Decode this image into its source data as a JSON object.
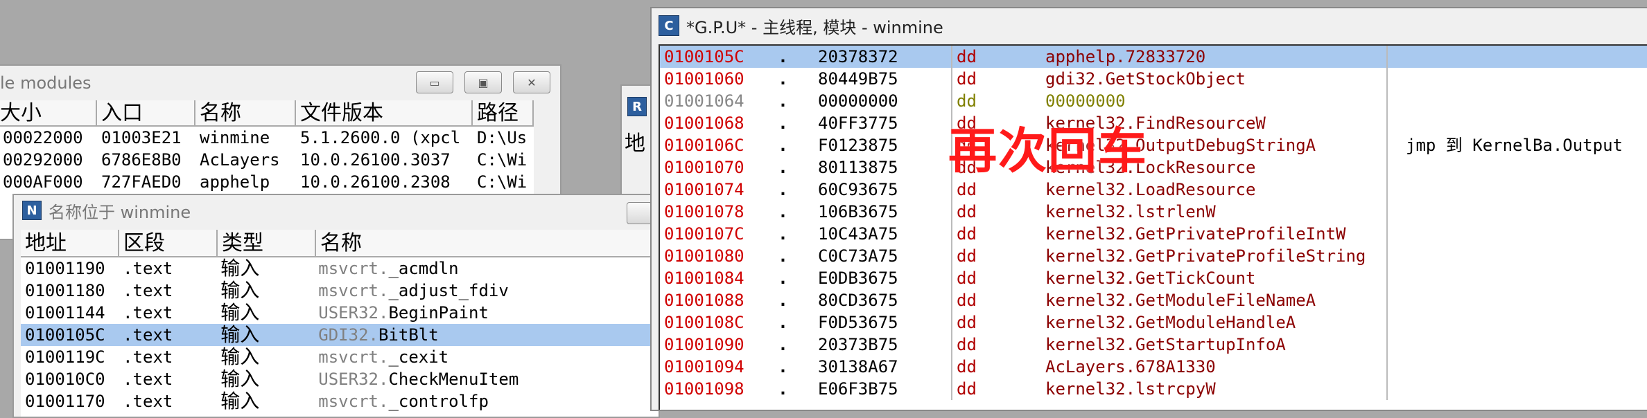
{
  "modules_window": {
    "title": "le modules",
    "buttons": [
      "▭",
      "▣",
      "✕"
    ],
    "columns": [
      "大小",
      "入口",
      "名称",
      "文件版本",
      "路径"
    ],
    "rows": [
      [
        "00022000",
        "01003E21",
        "winmine",
        "5.1.2600.0 (xpcl",
        "D:\\Us"
      ],
      [
        "00292000",
        "6786E8B0",
        "AcLayers",
        "10.0.26100.3037",
        "C:\\Wi"
      ],
      [
        "000AF000",
        "727FAED0",
        "apphelp",
        "10.0.26100.2308",
        "C:\\Wi"
      ]
    ]
  },
  "mini_window": {
    "icon": "R",
    "label": "地"
  },
  "names_window": {
    "icon": "N",
    "title": "名称位于 winmine",
    "columns": [
      "地址",
      "区段",
      "类型",
      "名称"
    ],
    "rows": [
      {
        "addr": "01001190",
        "section": ".text",
        "type": "输入",
        "mod": "msvcrt.",
        "fn": "_acmdln",
        "sel": false
      },
      {
        "addr": "01001180",
        "section": ".text",
        "type": "输入",
        "mod": "msvcrt.",
        "fn": "_adjust_fdiv",
        "sel": false
      },
      {
        "addr": "01001144",
        "section": ".text",
        "type": "输入",
        "mod": "USER32.",
        "fn": "BeginPaint",
        "sel": false
      },
      {
        "addr": "0100105C",
        "section": ".text",
        "type": "输入",
        "mod": "GDI32.",
        "fn": "BitBlt",
        "sel": true
      },
      {
        "addr": "0100119C",
        "section": ".text",
        "type": "输入",
        "mod": "msvcrt.",
        "fn": "_cexit",
        "sel": false
      },
      {
        "addr": "010010C0",
        "section": ".text",
        "type": "输入",
        "mod": "USER32.",
        "fn": "CheckMenuItem",
        "sel": false
      },
      {
        "addr": "01001170",
        "section": ".text",
        "type": "输入",
        "mod": "msvcrt.",
        "fn": "_controlfp",
        "sel": false
      }
    ]
  },
  "gpu_window": {
    "icon": "C",
    "title": "*G.P.U* -  主线程, 模块 - winmine",
    "rows": [
      {
        "addr": "0100105C",
        "dot": ".",
        "hex": "20378372",
        "op": "dd",
        "ref": "apphelp.72833720",
        "comment": "",
        "sel": true,
        "gray": false,
        "olive": false
      },
      {
        "addr": "01001060",
        "dot": ".",
        "hex": "80449B75",
        "op": "dd",
        "ref": "gdi32.GetStockObject",
        "comment": "",
        "sel": false,
        "gray": false,
        "olive": false
      },
      {
        "addr": "01001064",
        "dot": ".",
        "hex": "00000000",
        "op": "dd",
        "ref": "00000000",
        "comment": "",
        "sel": false,
        "gray": true,
        "olive": true
      },
      {
        "addr": "01001068",
        "dot": ".",
        "hex": "40FF3775",
        "op": "dd",
        "ref": "kernel32.FindResourceW",
        "comment": "",
        "sel": false,
        "gray": false,
        "olive": false
      },
      {
        "addr": "0100106C",
        "dot": ".",
        "hex": "F0123875",
        "op": "dd",
        "ref": "kernel32.OutputDebugStringA",
        "comment": "jmp 到 KernelBa.Output",
        "sel": false,
        "gray": false,
        "olive": false
      },
      {
        "addr": "01001070",
        "dot": ".",
        "hex": "80113875",
        "op": "dd",
        "ref": "kernel32.LockResource",
        "comment": "",
        "sel": false,
        "gray": false,
        "olive": false
      },
      {
        "addr": "01001074",
        "dot": ".",
        "hex": "60C93675",
        "op": "dd",
        "ref": "kernel32.LoadResource",
        "comment": "",
        "sel": false,
        "gray": false,
        "olive": false
      },
      {
        "addr": "01001078",
        "dot": ".",
        "hex": "106B3675",
        "op": "dd",
        "ref": "kernel32.lstrlenW",
        "comment": "",
        "sel": false,
        "gray": false,
        "olive": false
      },
      {
        "addr": "0100107C",
        "dot": ".",
        "hex": "10C43A75",
        "op": "dd",
        "ref": "kernel32.GetPrivateProfileIntW",
        "comment": "",
        "sel": false,
        "gray": false,
        "olive": false
      },
      {
        "addr": "01001080",
        "dot": ".",
        "hex": "C0C73A75",
        "op": "dd",
        "ref": "kernel32.GetPrivateProfileString",
        "comment": "",
        "sel": false,
        "gray": false,
        "olive": false
      },
      {
        "addr": "01001084",
        "dot": ".",
        "hex": "E0DB3675",
        "op": "dd",
        "ref": "kernel32.GetTickCount",
        "comment": "",
        "sel": false,
        "gray": false,
        "olive": false
      },
      {
        "addr": "01001088",
        "dot": ".",
        "hex": "80CD3675",
        "op": "dd",
        "ref": "kernel32.GetModuleFileNameA",
        "comment": "",
        "sel": false,
        "gray": false,
        "olive": false
      },
      {
        "addr": "0100108C",
        "dot": ".",
        "hex": "F0D53675",
        "op": "dd",
        "ref": "kernel32.GetModuleHandleA",
        "comment": "",
        "sel": false,
        "gray": false,
        "olive": false
      },
      {
        "addr": "01001090",
        "dot": ".",
        "hex": "20373B75",
        "op": "dd",
        "ref": "kernel32.GetStartupInfoA",
        "comment": "",
        "sel": false,
        "gray": false,
        "olive": false
      },
      {
        "addr": "01001094",
        "dot": ".",
        "hex": "30138A67",
        "op": "dd",
        "ref": "AcLayers.678A1330",
        "comment": "",
        "sel": false,
        "gray": false,
        "olive": false
      },
      {
        "addr": "01001098",
        "dot": ".",
        "hex": "E06F3B75",
        "op": "dd",
        "ref": "kernel32.lstrcpyW",
        "comment": "",
        "sel": false,
        "gray": false,
        "olive": false
      }
    ]
  },
  "overlay_text": "再次回车"
}
